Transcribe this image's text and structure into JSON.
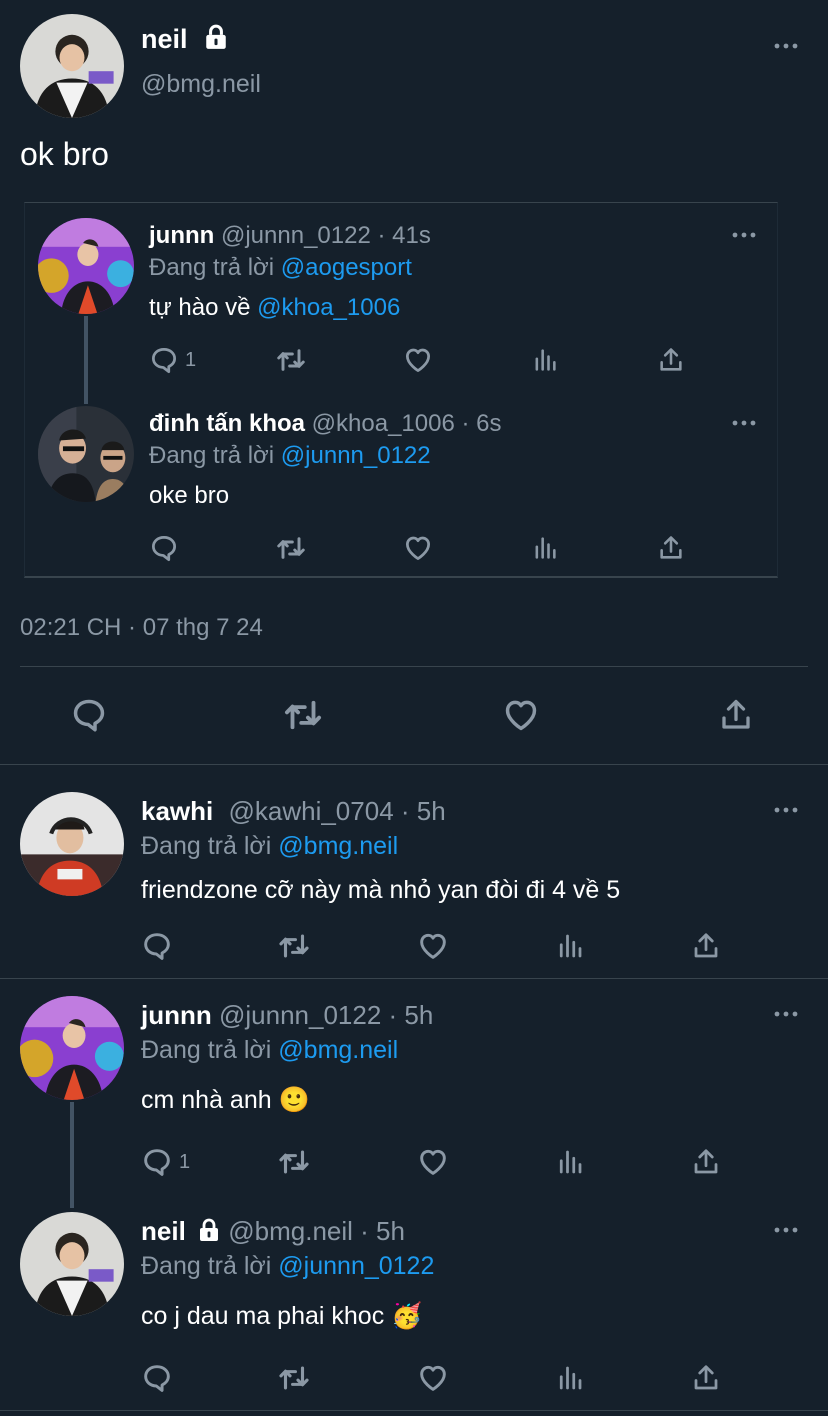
{
  "main_tweet": {
    "display_name": "neil",
    "handle": "@bmg.neil",
    "text": "ok bro",
    "timestamp": "02:21 CH · 07 thg 7 24",
    "quoted_thread": [
      {
        "display_name": "junnn",
        "handle": "@junnn_0122",
        "time": "· 41s",
        "reply_label": "Đang trả lời",
        "reply_to": "@aogesport",
        "text_prefix": "tự hào về ",
        "text_mention": "@khoa_1006",
        "reply_count": "1"
      },
      {
        "display_name": "đinh tấn khoa",
        "handle": "@khoa_1006",
        "time": "· 6s",
        "reply_label": "Đang trả lời",
        "reply_to": "@junnn_0122",
        "text": "oke bro",
        "reply_count": ""
      }
    ]
  },
  "replies": [
    {
      "display_name": "kawhi",
      "handle": "@kawhi_0704",
      "time": "· 5h",
      "reply_label": "Đang trả lời",
      "reply_to": "@bmg.neil",
      "text": "friendzone cỡ này mà nhỏ yan đòi đi 4 về 5",
      "reply_count": ""
    },
    {
      "display_name": "junnn",
      "handle": "@junnn_0122",
      "time": "· 5h",
      "reply_label": "Đang trả lời",
      "reply_to": "@bmg.neil",
      "text": "cm nhà anh",
      "emoji": "🙂",
      "reply_count": "1"
    },
    {
      "display_name": "neil",
      "handle": "@bmg.neil",
      "time": "· 5h",
      "reply_label": "Đang trả lời",
      "reply_to": "@junnn_0122",
      "text": "co j dau ma phai khoc",
      "emoji": "🥳",
      "reply_count": ""
    }
  ],
  "icons": {
    "reply": "reply-icon",
    "retweet": "retweet-icon",
    "like": "heart-icon",
    "views": "views-icon",
    "share": "share-icon",
    "more": "more-icon",
    "lock": "lock-icon"
  },
  "colors": {
    "background": "#15202b",
    "accent": "#1d9bf0",
    "muted": "#8b98a5",
    "divider": "#38444d"
  }
}
